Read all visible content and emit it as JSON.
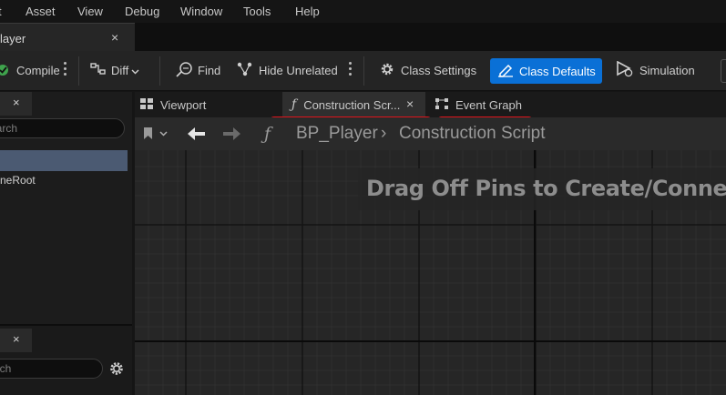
{
  "menu": {
    "items": [
      "t",
      "Asset",
      "View",
      "Debug",
      "Window",
      "Tools",
      "Help"
    ]
  },
  "asset_tab": {
    "label": "layer",
    "close": "×"
  },
  "toolbar": {
    "compile": "Compile",
    "diff": "Diff",
    "find": "Find",
    "hide_unrelated": "Hide Unrelated",
    "class_settings": "Class Settings",
    "class_defaults": "Class Defaults",
    "simulation": "Simulation"
  },
  "left_panel": {
    "close": "×",
    "search_placeholder": "earch",
    "tree_item": "neRoot",
    "lower_close": "×",
    "lower_search_placeholder": "arch"
  },
  "graph_tabs": {
    "viewport": "Viewport",
    "construction": "Construction Scr...",
    "construction_close": "×",
    "event_graph": "Event Graph"
  },
  "breadcrumb": {
    "func_glyph": "ƒ",
    "blueprint": "BP_Player",
    "separator": "›",
    "current": "Construction Script"
  },
  "hint": {
    "text": "Drag Off Pins to Create/Connec"
  },
  "colors": {
    "accent": "#0a70d6",
    "annotation": "#e0141c",
    "selection": "#4b5a72"
  }
}
